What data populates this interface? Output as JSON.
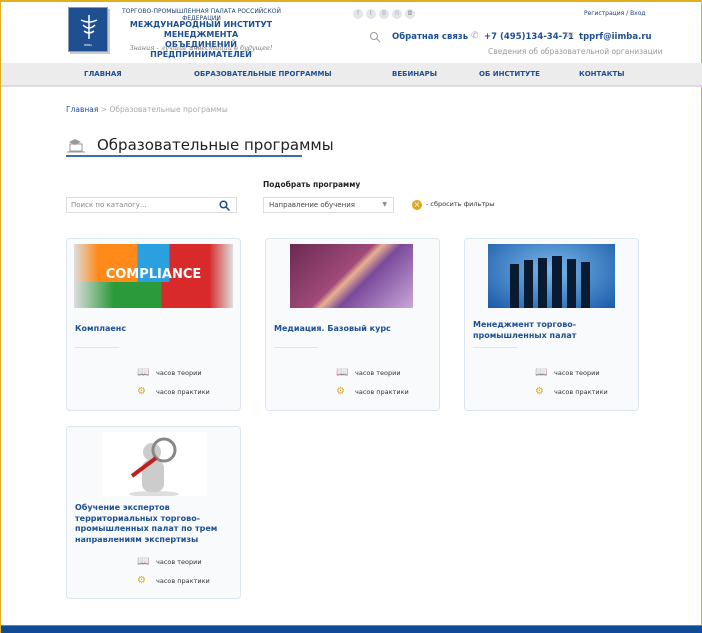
{
  "header": {
    "logo_text": "IIMBA",
    "chamber": "ТОРГОВО-ПРОМЫШЛЕННАЯ ПАЛАТА РОССИЙСКОЙ ФЕДЕРАЦИИ",
    "institute_line1": "МЕЖДУНАРОДНЫЙ ИНСТИТУТ МЕНЕДЖМЕНТА",
    "institute_line2": "ОБЪЕДИНЕНИЙ ПРЕДПРИНИМАТЕЛЕЙ",
    "slogan": "Знания - лучшие инвестиции в будущее!",
    "social": [
      "f",
      "t",
      "В",
      "п",
      "◘"
    ],
    "auth": "Регистрация / Вход",
    "feedback": "Обратная связь",
    "phone": "+7 (495)134-34-71",
    "email": "tpprf@iimba.ru",
    "edu_info": "Сведения об образовательной организации"
  },
  "nav": [
    "ГЛАВНАЯ",
    "ОБРАЗОВАТЕЛЬНЫЕ ПРОГРАММЫ",
    "ВЕБИНАРЫ",
    "ОБ ИНСТИТУТЕ",
    "КОНТАКТЫ"
  ],
  "breadcrumb": {
    "home": "Главная",
    "sep": " > ",
    "current": "Образовательные программы"
  },
  "page_title": "Образовательные программы",
  "filters": {
    "label": "Подобрать программу",
    "search_placeholder": "Поиск по каталогу...",
    "direction": "Направление обучения",
    "reset": "- сбросить фильтры"
  },
  "cards": [
    {
      "title": "Комплаенс",
      "image_text": "COMPLIANCE",
      "theory": "часов теории",
      "practice": "часов практики"
    },
    {
      "title": "Медиация. Базовый курс",
      "theory": "часов теории",
      "practice": "часов практики"
    },
    {
      "title": "Менеджмент торгово-промышленных палат",
      "theory": "часов теории",
      "practice": "часов практики"
    },
    {
      "title": "Обучение экспертов территориальных торгово-промышленных палат по трем направлениям экспертизы",
      "theory": "часов теории",
      "practice": "часов практики"
    }
  ],
  "colors": {
    "brand": "#1d4f91",
    "accent": "#e0a820",
    "footer": "#0f4c96"
  }
}
